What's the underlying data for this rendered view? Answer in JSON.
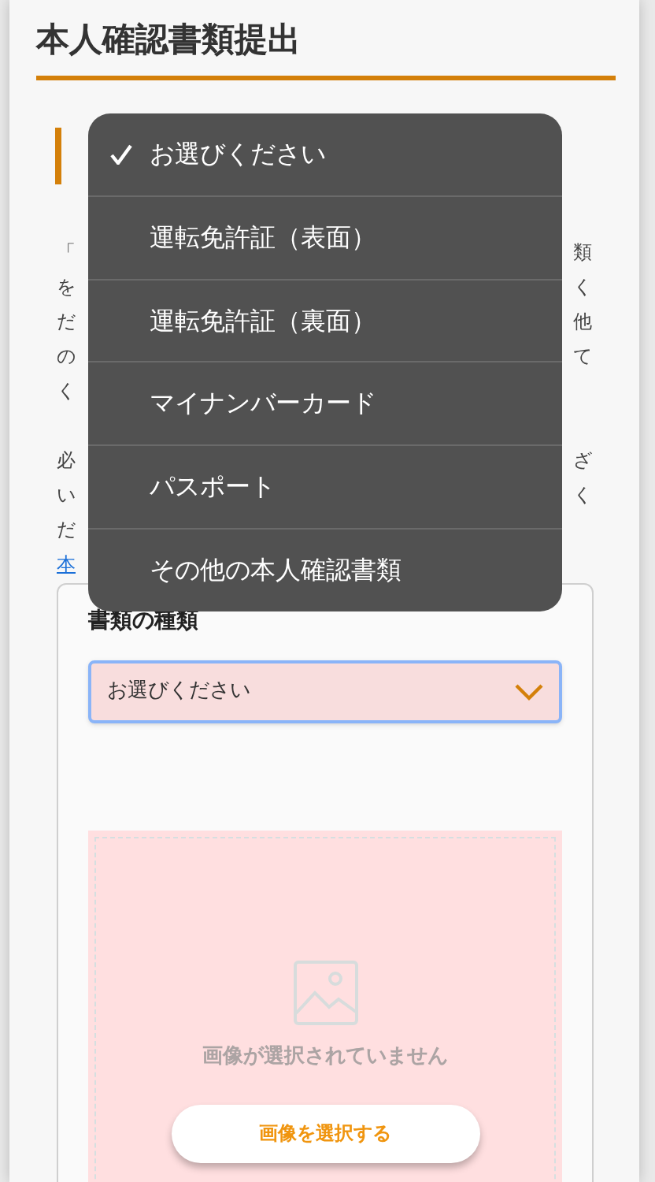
{
  "page_title": "本人確認書類提出",
  "intro_lines": [
    {
      "left": "「",
      "right": "類"
    },
    {
      "left": "を",
      "right": "く"
    },
    {
      "left": "だ",
      "right": "他"
    },
    {
      "left": "の",
      "right": "て"
    },
    {
      "left": "く"
    }
  ],
  "note_lines": [
    {
      "left": "必",
      "right": "ざ"
    },
    {
      "left": "い",
      "right": "く"
    },
    {
      "left": "だ"
    }
  ],
  "link_fragment": "本",
  "document_type": {
    "label": "書類の種類",
    "value": "お選びください"
  },
  "upload": {
    "empty_text": "画像が選択されていません",
    "button": "画像を選択する"
  },
  "dropdown_menu": {
    "options": [
      {
        "label": "お選びください",
        "selected": true
      },
      {
        "label": "運転免許証（表面）",
        "selected": false
      },
      {
        "label": "運転免許証（裏面）",
        "selected": false
      },
      {
        "label": "マイナンバーカード",
        "selected": false
      },
      {
        "label": "パスポート",
        "selected": false
      },
      {
        "label": "その他の本人確認書類",
        "selected": false
      }
    ]
  }
}
